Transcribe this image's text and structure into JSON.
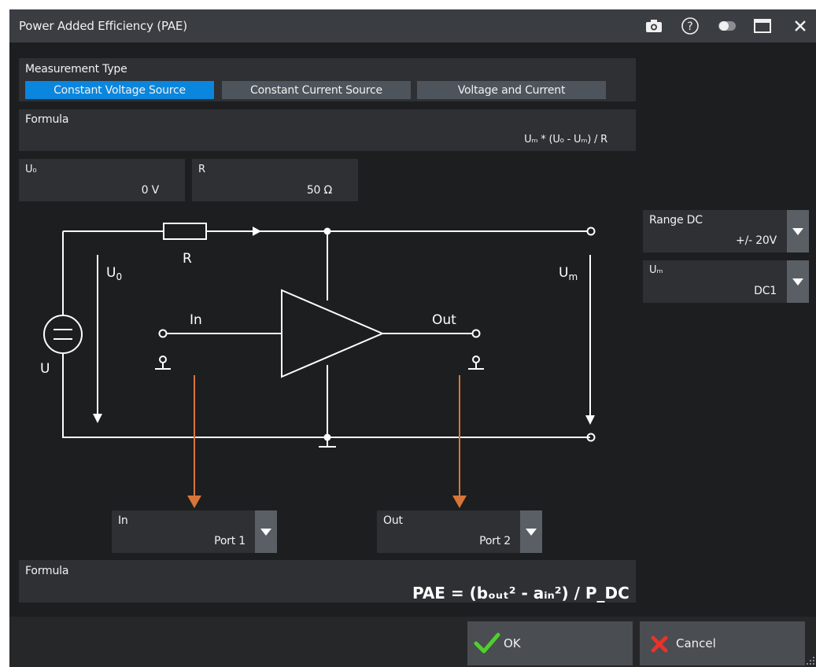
{
  "window": {
    "title": "Power Added Efficiency (PAE)"
  },
  "titlebar_icons": [
    "camera-icon",
    "help-icon",
    "toggle-icon",
    "maximize-icon",
    "close-icon"
  ],
  "measurement_type": {
    "label": "Measurement Type",
    "options": [
      "Constant Voltage Source",
      "Constant Current Source",
      "Voltage and Current"
    ],
    "selected": "Constant Voltage Source"
  },
  "formula_top": {
    "label": "Formula",
    "expression": "Uₘ * (U₀ - Uₘ) / R"
  },
  "u0": {
    "label": "U₀",
    "value": "0 V"
  },
  "r": {
    "label": "R",
    "value": "50 Ω"
  },
  "range_dc": {
    "label": "Range DC",
    "value": "+/- 20V"
  },
  "um": {
    "label": "Uₘ",
    "value": "DC1"
  },
  "diagram": {
    "label_u0_main": "U",
    "label_u0_sub": "0",
    "label_r": "R",
    "label_um_main": "U",
    "label_um_sub": "m",
    "label_u": "U",
    "label_in": "In",
    "label_out": "Out"
  },
  "in_port": {
    "label": "In",
    "value": "Port 1"
  },
  "out_port": {
    "label": "Out",
    "value": "Port 2"
  },
  "formula_bottom": {
    "label": "Formula",
    "expression": "PAE = (bₒᵤₜ² - aᵢₙ²) / P_DC"
  },
  "buttons": {
    "ok": "OK",
    "cancel": "Cancel"
  },
  "colors": {
    "accent": "#0a86dd",
    "arrow": "#d8753a",
    "titlebar": "#3a3d41",
    "panel": "#2e3034"
  }
}
